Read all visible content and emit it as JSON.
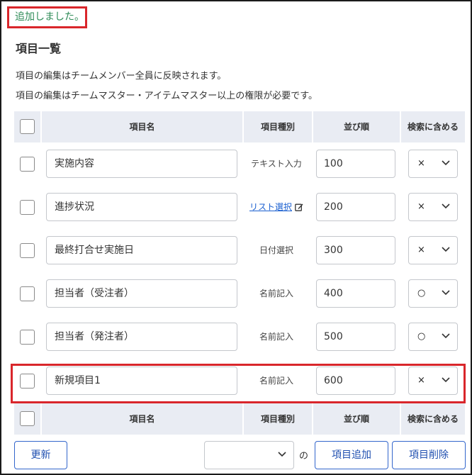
{
  "flash_message": "追加しました。",
  "page_title": "項目一覧",
  "descriptions": [
    "項目の編集はチームメンバー全員に反映されます。",
    "項目の編集はチームマスター・アイテムマスター以上の権限が必要です。"
  ],
  "table": {
    "headers": [
      "項目名",
      "項目種別",
      "並び順",
      "検索に含める"
    ],
    "rows": [
      {
        "name": "実施内容",
        "type": "テキスト入力",
        "type_is_link": false,
        "order": "100",
        "search": "×"
      },
      {
        "name": "進捗状況",
        "type": "リスト選択",
        "type_is_link": true,
        "order": "200",
        "search": "×"
      },
      {
        "name": "最終打合せ実施日",
        "type": "日付選択",
        "type_is_link": false,
        "order": "300",
        "search": "×"
      },
      {
        "name": "担当者（受注者）",
        "type": "名前記入",
        "type_is_link": false,
        "order": "400",
        "search": "○"
      },
      {
        "name": "担当者（発注者）",
        "type": "名前記入",
        "type_is_link": false,
        "order": "500",
        "search": "○"
      },
      {
        "name": "新規項目1",
        "type": "名前記入",
        "type_is_link": false,
        "order": "600",
        "search": "×"
      }
    ]
  },
  "footer": {
    "update_label": "更新",
    "position_select_value": "",
    "no_label": "の",
    "add_label": "項目追加",
    "delete_label": "項目削除"
  },
  "colors": {
    "accent_border": "#d9262b",
    "success_text": "#2e8b57",
    "button_blue": "#1f4fb0",
    "link_blue": "#1a5fd0",
    "header_bg": "#e9ecf3"
  },
  "icons": [
    "chevron-down-icon",
    "edit-icon"
  ]
}
